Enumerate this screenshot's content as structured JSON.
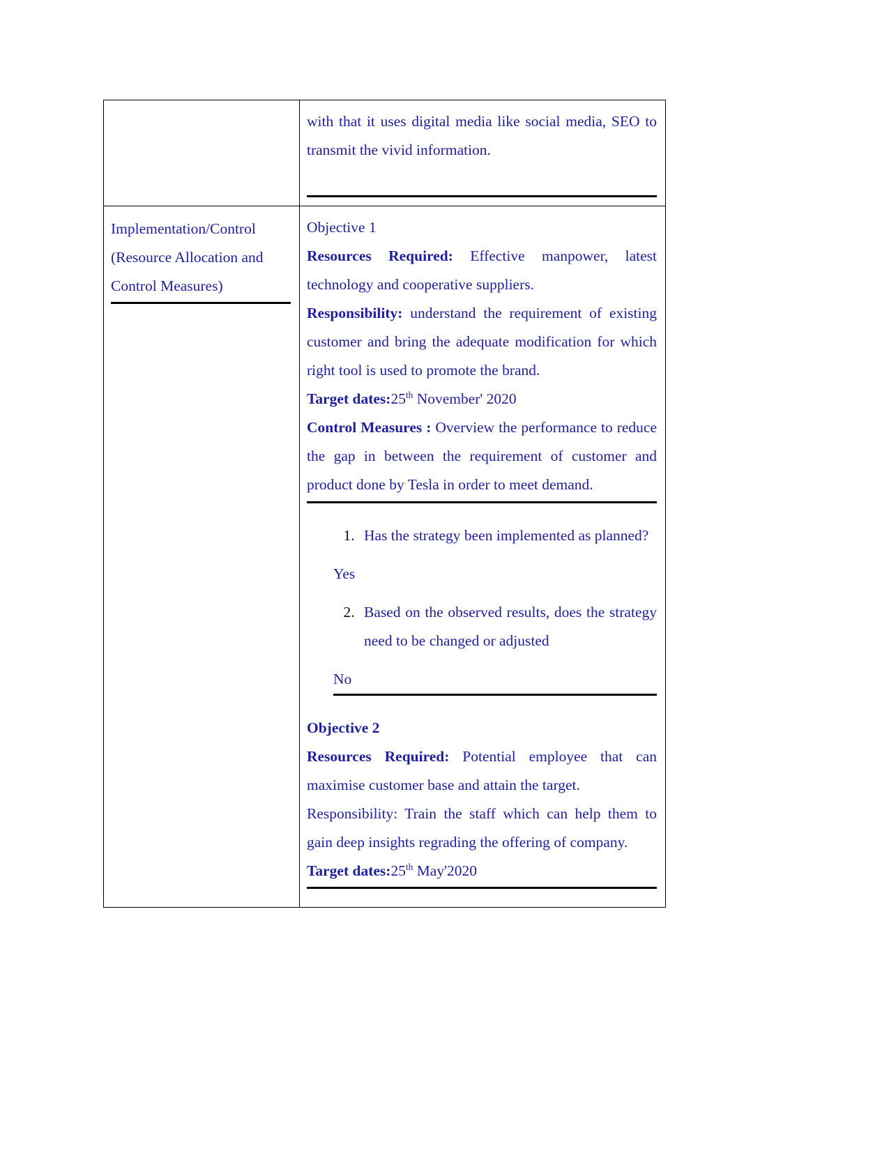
{
  "document": {
    "text_color": "#1f1f9c",
    "rule_color": "#000000",
    "table": {
      "rows": [
        {
          "left": {
            "paragraphs": []
          },
          "right": {
            "continued_paragraph": "with that it uses digital media like social media, SEO to transmit the vivid information."
          }
        },
        {
          "left": {
            "line1": "Implementation/Control",
            "line2": "(Resource Allocation and",
            "line3": "Control Measures)"
          },
          "right": {
            "objective1": {
              "heading": "Objective 1",
              "resources_label": "Resources Required:",
              "resources_text": " Effective manpower, latest technology and cooperative suppliers.",
              "responsibility_label": "Responsibility:",
              "responsibility_text": " understand the requirement of existing customer and bring the adequate modification for which right tool is used to promote the brand.",
              "target_dates_label": "Target dates:",
              "target_dates_day": "25",
              "target_dates_ordinal": "th",
              "target_dates_rest": " November' 2020",
              "control_measures_label": "Control Measures :",
              "control_measures_text": " Overview the performance to reduce the gap in between the requirement of customer and product done by Tesla in order to meet demand.",
              "questions": [
                {
                  "number": "1.",
                  "text": "Has the strategy been implemented as planned?",
                  "answer": "Yes"
                },
                {
                  "number": "2.",
                  "text": "Based on the observed results, does the strategy need to be changed or adjusted",
                  "answer": "No"
                }
              ]
            },
            "objective2": {
              "heading": "Objective 2",
              "resources_label": "Resources Required:",
              "resources_text": " Potential employee that can maximise customer base and attain the target.",
              "responsibility_label": "Responsibility:",
              "responsibility_text": " Train the staff which can help them to gain deep insights regrading the offering of company.",
              "target_dates_label": "Target dates:",
              "target_dates_day": "25",
              "target_dates_ordinal": "th",
              "target_dates_rest": " May'2020"
            }
          }
        }
      ]
    }
  }
}
